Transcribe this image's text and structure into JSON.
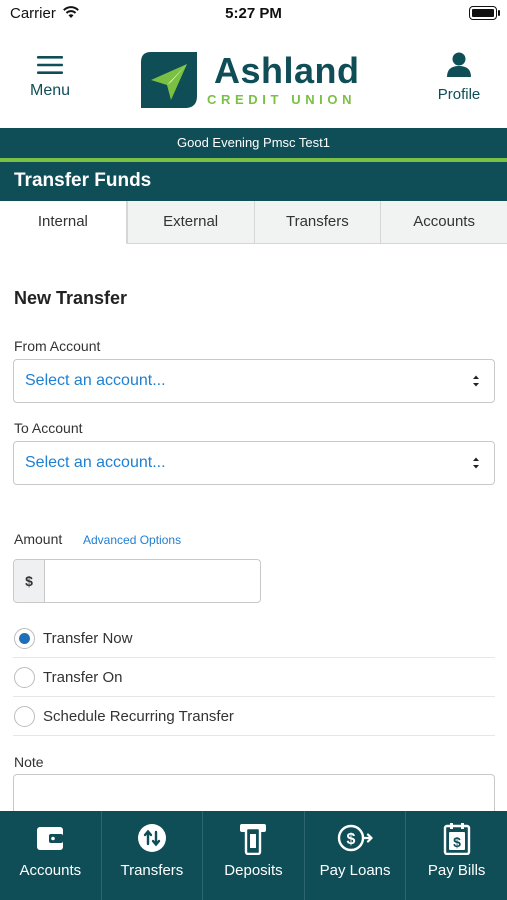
{
  "status_bar": {
    "carrier": "Carrier",
    "time": "5:27 PM"
  },
  "header": {
    "menu_label": "Menu",
    "brand_name": "Ashland",
    "brand_sub": "CREDIT UNION",
    "profile_label": "Profile"
  },
  "greeting": "Good Evening Pmsc Test1",
  "page_title": "Transfer Funds",
  "tabs": [
    {
      "label": "Internal",
      "active": true
    },
    {
      "label": "External",
      "active": false
    },
    {
      "label": "Transfers",
      "active": false
    },
    {
      "label": "Accounts",
      "active": false
    }
  ],
  "form": {
    "section_title": "New Transfer",
    "from_label": "From Account",
    "from_value": "Select an account...",
    "to_label": "To Account",
    "to_value": "Select an account...",
    "amount_label": "Amount",
    "advanced_link": "Advanced Options",
    "currency_prefix": "$",
    "amount_value": "",
    "radio_options": [
      {
        "label": "Transfer Now",
        "checked": true
      },
      {
        "label": "Transfer On",
        "checked": false
      },
      {
        "label": "Schedule Recurring Transfer",
        "checked": false
      }
    ],
    "note_label": "Note",
    "note_value": ""
  },
  "bottom_nav": [
    {
      "label": "Accounts",
      "icon": "wallet-icon"
    },
    {
      "label": "Transfers",
      "icon": "transfer-arrows-icon"
    },
    {
      "label": "Deposits",
      "icon": "deposit-check-icon"
    },
    {
      "label": "Pay Loans",
      "icon": "dollar-circle-arrow-icon"
    },
    {
      "label": "Pay Bills",
      "icon": "bill-dollar-icon"
    }
  ],
  "colors": {
    "brand_teal": "#0f4d57",
    "brand_green": "#7ac143",
    "link_blue": "#1f7fd1",
    "radio_blue": "#1f6fb8"
  }
}
